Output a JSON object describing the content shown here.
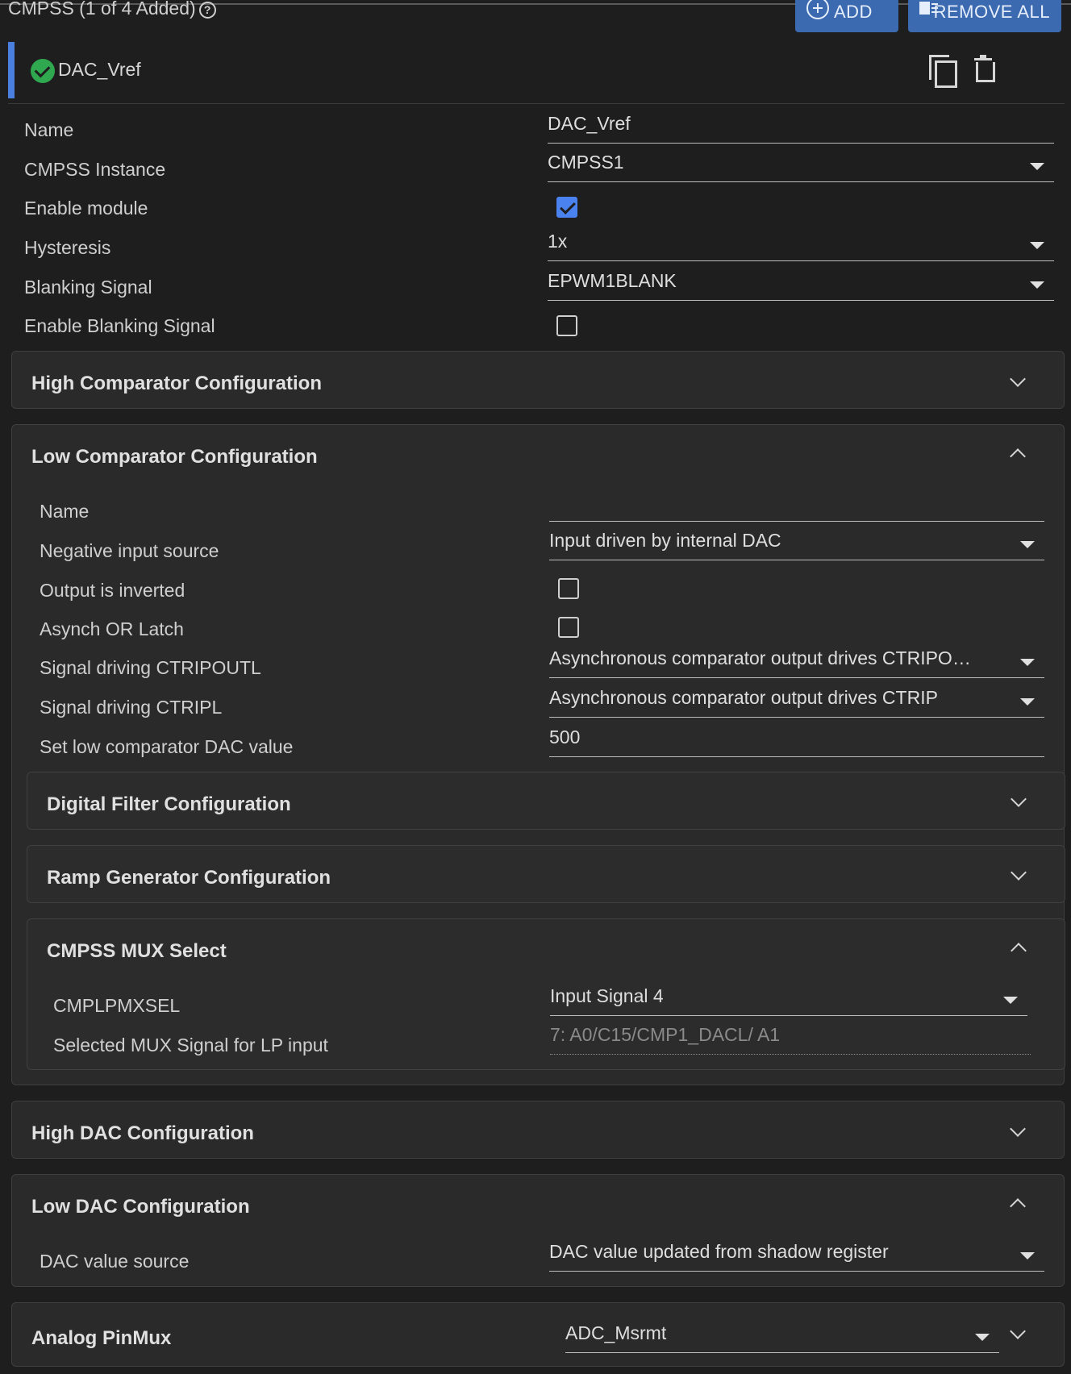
{
  "header": {
    "title": "CMPSS (1 of 4 Added)",
    "add_label": "ADD",
    "remove_all_label": "REMOVE ALL"
  },
  "instance": {
    "name": "DAC_Vref"
  },
  "fields": {
    "name_label": "Name",
    "name_value": "DAC_Vref",
    "instance_label": "CMPSS Instance",
    "instance_value": "CMPSS1",
    "enable_label": "Enable module",
    "enable_checked": true,
    "hysteresis_label": "Hysteresis",
    "hysteresis_value": "1x",
    "blanking_label": "Blanking Signal",
    "blanking_value": "EPWM1BLANK",
    "enable_blank_label": "Enable Blanking Signal",
    "enable_blank_checked": false
  },
  "high_comp": {
    "title": "High Comparator Configuration"
  },
  "low_comp": {
    "title": "Low Comparator Configuration",
    "name_label": "Name",
    "name_value": "",
    "neg_label": "Negative input source",
    "neg_value": "Input driven by internal DAC",
    "inverted_label": "Output is inverted",
    "inverted_checked": false,
    "asynch_label": "Asynch OR Latch",
    "asynch_checked": false,
    "ctripout_label": "Signal driving CTRIPOUTL",
    "ctripout_value": "Asynchronous comparator output drives CTRIPO…",
    "ctrip_label": "Signal driving CTRIPL",
    "ctrip_value": "Asynchronous comparator output drives CTRIP",
    "dac_label": "Set low comparator DAC value",
    "dac_value": "500"
  },
  "digital_filter": {
    "title": "Digital Filter Configuration"
  },
  "ramp_gen": {
    "title": "Ramp Generator Configuration"
  },
  "mux": {
    "title": "CMPSS MUX Select",
    "sel_label": "CMPLPMXSEL",
    "sel_value": "Input Signal 4",
    "signal_label": "Selected MUX Signal for LP input",
    "signal_value": "7: A0/C15/CMP1_DACL/ A1"
  },
  "high_dac": {
    "title": "High DAC Configuration"
  },
  "low_dac": {
    "title": "Low DAC Configuration",
    "source_label": "DAC value source",
    "source_value": "DAC value updated from shadow register"
  },
  "pinmux": {
    "title": "Analog PinMux",
    "value": "ADC_Msrmt"
  },
  "colors": {
    "accent": "#4a82f0",
    "button": "#3b6ab0",
    "success": "#2fa84f",
    "background": "#1e1e1e",
    "panel": "#2a2a2a"
  }
}
